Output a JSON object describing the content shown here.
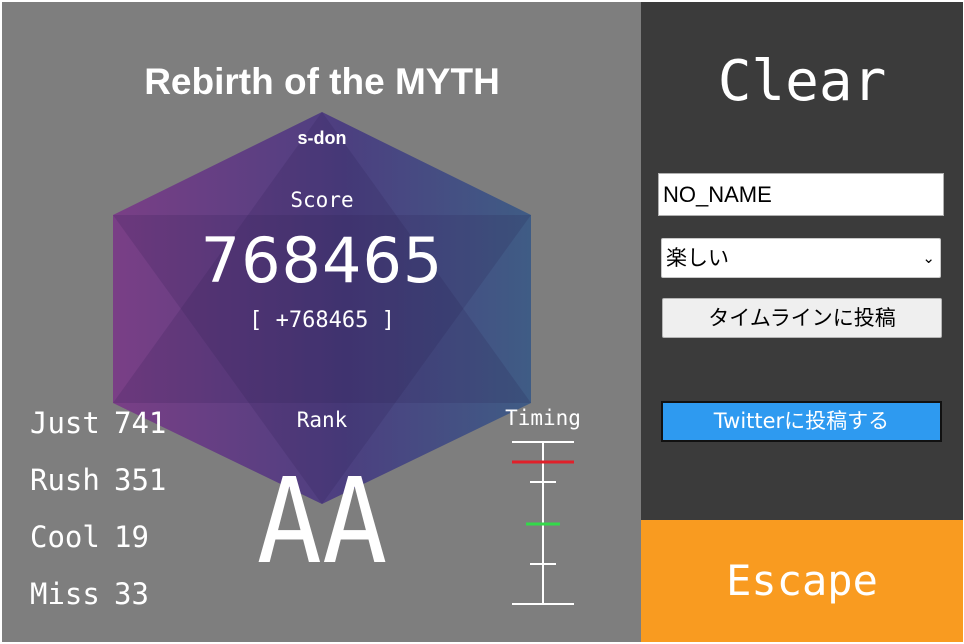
{
  "song": {
    "title": "Rebirth of the MYTH",
    "player": "s-don"
  },
  "score": {
    "label": "Score",
    "value": "768465",
    "diff": "[ +768465 ]"
  },
  "rank": {
    "label": "Rank",
    "value": "AA"
  },
  "judgements": [
    {
      "name": "Just",
      "count": "741"
    },
    {
      "name": "Rush",
      "count": "351"
    },
    {
      "name": "Cool",
      "count": "19"
    },
    {
      "name": "Miss",
      "count": "33"
    }
  ],
  "timing": {
    "label": "Timing",
    "early_marker_color": "#e0202a",
    "center_marker_color": "#33d94a"
  },
  "result_banner": {
    "title": "Clear"
  },
  "post_form": {
    "name_value": "NO_NAME",
    "mood_selected": "楽しい",
    "timeline_button": "タイムラインに投稿",
    "twitter_button": "Twitterに投稿する"
  },
  "escape": {
    "label": "Escape"
  },
  "colors": {
    "left_bg": "#7e7e7e",
    "right_bg": "#3b3b3b",
    "hexagon_left": "#7a3f86",
    "hexagon_right": "#3f5c85",
    "twitter": "#2e9af0",
    "escape": "#f99b20"
  },
  "icons": {
    "select_arrow": "chevron-down-icon"
  }
}
